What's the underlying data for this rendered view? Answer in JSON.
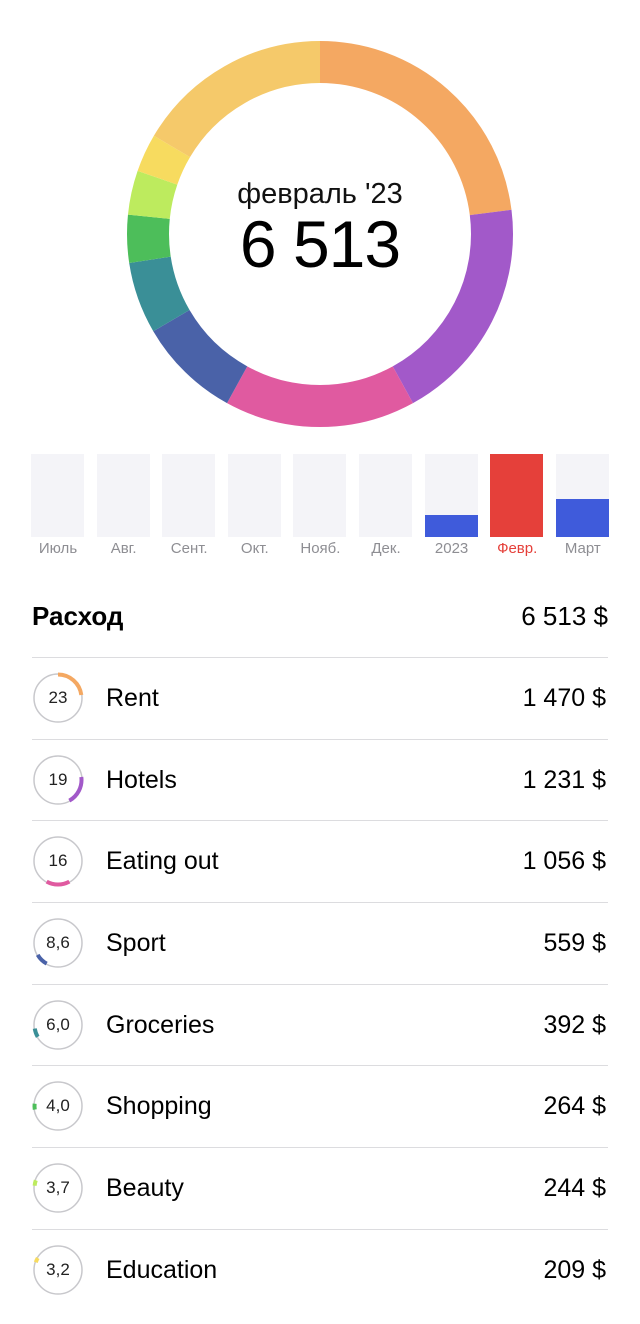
{
  "header": {
    "month": "февраль '23",
    "total": "6 513"
  },
  "donut": {
    "segments": [
      {
        "category": "Rent",
        "percent": 23,
        "color": "#F4A862"
      },
      {
        "category": "Hotels",
        "percent": 19,
        "color": "#A259C9"
      },
      {
        "category": "Eating out",
        "percent": 16,
        "color": "#E05AA0"
      },
      {
        "category": "Sport",
        "percent": 8.6,
        "color": "#4A62A8"
      },
      {
        "category": "Groceries",
        "percent": 6.0,
        "color": "#3A8F97"
      },
      {
        "category": "Shopping",
        "percent": 4.0,
        "color": "#4DBE5A"
      },
      {
        "category": "Beauty",
        "percent": 3.7,
        "color": "#BDEB5E"
      },
      {
        "category": "Education",
        "percent": 3.2,
        "color": "#F7DB5F"
      },
      {
        "category": "other",
        "percent": 16.5,
        "color": "#F5C96A"
      }
    ]
  },
  "months": [
    {
      "label": "Июль",
      "fill": 0,
      "color": "#3F5BDB"
    },
    {
      "label": "Авг.",
      "fill": 0,
      "color": "#3F5BDB"
    },
    {
      "label": "Сент.",
      "fill": 0,
      "color": "#3F5BDB"
    },
    {
      "label": "Окт.",
      "fill": 0,
      "color": "#3F5BDB"
    },
    {
      "label": "Нояб.",
      "fill": 0,
      "color": "#3F5BDB"
    },
    {
      "label": "Дек.",
      "fill": 0,
      "color": "#3F5BDB"
    },
    {
      "label": "2023",
      "fill": 0.26,
      "color": "#3F5BDB"
    },
    {
      "label": "Февр.",
      "fill": 1.0,
      "color": "#E5403A",
      "active": true
    },
    {
      "label": "Март",
      "fill": 0.46,
      "color": "#3F5BDB"
    }
  ],
  "summary": {
    "title": "Расход",
    "amount": "6 513 $"
  },
  "categories": [
    {
      "pct": "23",
      "name": "Rent",
      "amount": "1 470 $"
    },
    {
      "pct": "19",
      "name": "Hotels",
      "amount": "1 231 $"
    },
    {
      "pct": "16",
      "name": "Eating out",
      "amount": "1 056 $"
    },
    {
      "pct": "8,6",
      "name": "Sport",
      "amount": "559 $"
    },
    {
      "pct": "6,0",
      "name": "Groceries",
      "amount": "392 $"
    },
    {
      "pct": "4,0",
      "name": "Shopping",
      "amount": "264 $"
    },
    {
      "pct": "3,7",
      "name": "Beauty",
      "amount": "244 $"
    },
    {
      "pct": "3,2",
      "name": "Education",
      "amount": "209 $"
    }
  ]
}
